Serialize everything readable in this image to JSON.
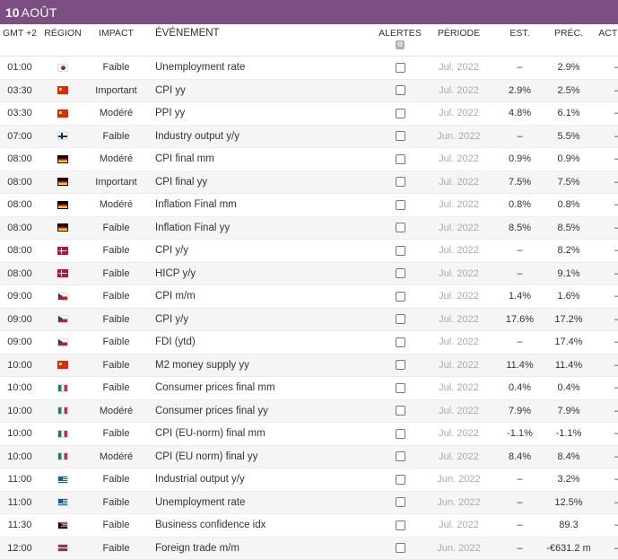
{
  "header": {
    "day": "10",
    "month": "AOÛT"
  },
  "columns": {
    "time": "GMT +2",
    "region": "RÉGION",
    "impact": "IMPACT",
    "event": "ÉVÉNEMENT",
    "alerts": "ALERTES",
    "period": "PÉRIODE",
    "est": "EST.",
    "prev": "PRÉC.",
    "actual": "ACTUEL"
  },
  "rows": [
    {
      "time": "01:00",
      "flag": "kr",
      "impact": "Faible",
      "event": "Unemployment rate",
      "period": "Jul. 2022",
      "est": "–",
      "prev": "2.9%",
      "actual": "–"
    },
    {
      "time": "03:30",
      "flag": "cn",
      "impact": "Important",
      "event": "CPI yy",
      "period": "Jul. 2022",
      "est": "2.9%",
      "prev": "2.5%",
      "actual": "–"
    },
    {
      "time": "03:30",
      "flag": "cn",
      "impact": "Modéré",
      "event": "PPI yy",
      "period": "Jul. 2022",
      "est": "4.8%",
      "prev": "6.1%",
      "actual": "–"
    },
    {
      "time": "07:00",
      "flag": "fi",
      "impact": "Faible",
      "event": "Industry output y/y",
      "period": "Jun. 2022",
      "est": "–",
      "prev": "5.5%",
      "actual": "–"
    },
    {
      "time": "08:00",
      "flag": "de",
      "impact": "Modéré",
      "event": "CPI final mm",
      "period": "Jul. 2022",
      "est": "0.9%",
      "prev": "0.9%",
      "actual": "–"
    },
    {
      "time": "08:00",
      "flag": "de",
      "impact": "Important",
      "event": "CPI final yy",
      "period": "Jul. 2022",
      "est": "7.5%",
      "prev": "7.5%",
      "actual": "–"
    },
    {
      "time": "08:00",
      "flag": "de",
      "impact": "Modéré",
      "event": "Inflation Final mm",
      "period": "Jul. 2022",
      "est": "0.8%",
      "prev": "0.8%",
      "actual": "–"
    },
    {
      "time": "08:00",
      "flag": "de",
      "impact": "Faible",
      "event": "Inflation Final yy",
      "period": "Jul. 2022",
      "est": "8.5%",
      "prev": "8.5%",
      "actual": "–"
    },
    {
      "time": "08:00",
      "flag": "dk",
      "impact": "Faible",
      "event": "CPI y/y",
      "period": "Jul. 2022",
      "est": "–",
      "prev": "8.2%",
      "actual": "–"
    },
    {
      "time": "08:00",
      "flag": "dk",
      "impact": "Faible",
      "event": "HICP y/y",
      "period": "Jul. 2022",
      "est": "–",
      "prev": "9.1%",
      "actual": "–"
    },
    {
      "time": "09:00",
      "flag": "cz",
      "impact": "Faible",
      "event": "CPI m/m",
      "period": "Jul. 2022",
      "est": "1.4%",
      "prev": "1.6%",
      "actual": "–"
    },
    {
      "time": "09:00",
      "flag": "cz",
      "impact": "Faible",
      "event": "CPI y/y",
      "period": "Jul. 2022",
      "est": "17.6%",
      "prev": "17.2%",
      "actual": "–"
    },
    {
      "time": "09:00",
      "flag": "cz",
      "impact": "Faible",
      "event": "FDI (ytd)",
      "period": "Jul. 2022",
      "est": "–",
      "prev": "17.4%",
      "actual": "–"
    },
    {
      "time": "10:00",
      "flag": "cn",
      "impact": "Faible",
      "event": "M2 money supply yy",
      "period": "Jul. 2022",
      "est": "11.4%",
      "prev": "11.4%",
      "actual": "–"
    },
    {
      "time": "10:00",
      "flag": "it",
      "impact": "Faible",
      "event": "Consumer prices final mm",
      "period": "Jul. 2022",
      "est": "0.4%",
      "prev": "0.4%",
      "actual": "–"
    },
    {
      "time": "10:00",
      "flag": "it",
      "impact": "Modéré",
      "event": "Consumer prices final yy",
      "period": "Jul. 2022",
      "est": "7.9%",
      "prev": "7.9%",
      "actual": "–"
    },
    {
      "time": "10:00",
      "flag": "it",
      "impact": "Faible",
      "event": "CPI (EU-norm) final mm",
      "period": "Jul. 2022",
      "est": "-1.1%",
      "prev": "-1.1%",
      "actual": "–"
    },
    {
      "time": "10:00",
      "flag": "it",
      "impact": "Modéré",
      "event": "CPI (EU norm) final yy",
      "period": "Jul. 2022",
      "est": "8.4%",
      "prev": "8.4%",
      "actual": "–"
    },
    {
      "time": "11:00",
      "flag": "gr",
      "impact": "Faible",
      "event": "Industrial output y/y",
      "period": "Jun. 2022",
      "est": "–",
      "prev": "3.2%",
      "actual": "–"
    },
    {
      "time": "11:00",
      "flag": "gr",
      "impact": "Faible",
      "event": "Unemployment rate",
      "period": "Jun. 2022",
      "est": "–",
      "prev": "12.5%",
      "actual": "–"
    },
    {
      "time": "11:30",
      "flag": "za",
      "impact": "Faible",
      "event": "Business confidence idx",
      "period": "Jul. 2022",
      "est": "–",
      "prev": "89.3",
      "actual": "–"
    },
    {
      "time": "12:00",
      "flag": "lv",
      "impact": "Faible",
      "event": "Foreign trade m/m",
      "period": "Jun. 2022",
      "est": "–",
      "prev": "-€631.2 m",
      "actual": "–"
    }
  ],
  "colors": {
    "header_bg": "#7b4f82"
  },
  "icons": {
    "alerts_settings": "gear-icon"
  }
}
